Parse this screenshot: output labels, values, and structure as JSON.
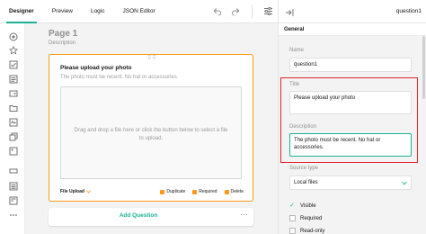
{
  "tabs": [
    {
      "label": "Designer",
      "active": true
    },
    {
      "label": "Preview",
      "active": false
    },
    {
      "label": "Logic",
      "active": false
    },
    {
      "label": "JSON Editor",
      "active": false
    }
  ],
  "toolbar": {
    "icons": [
      "undo-icon",
      "redo-icon",
      "settings-icon"
    ]
  },
  "rail": {
    "icons": [
      "circle-radio-icon",
      "star-rating-icon",
      "checkbox-icon",
      "list-icon",
      "dropdown-icon",
      "file-icon",
      "text-block-icon",
      "copy-icon",
      "image-icon",
      "input-icon",
      "panel-icon",
      "more-icon"
    ]
  },
  "page": {
    "title": "Page 1",
    "description": "Description"
  },
  "question": {
    "title": "Please upload your photo",
    "description": "The photo must be recent. No hat or accessories.",
    "dropzone_text": "Drag and drop a file here or click the button below to select a file to upload.",
    "type_label": "File Upload",
    "actions": {
      "duplicate": "Duplicate",
      "required": "Required",
      "delete": "Delete"
    },
    "drag_handle": "⠿⠿"
  },
  "add_question": {
    "label": "Add Question",
    "more": "···"
  },
  "panel": {
    "question_name": "question1",
    "section": "General",
    "name_label": "Name",
    "name_value": "question1",
    "title_label": "Title",
    "title_value": "Please upload your photo",
    "description_label": "Description",
    "description_value": "The photo must be recent. No hat or accessories.",
    "source_type_label": "Source type",
    "source_type_value": "Local files",
    "visible_label": "Visible",
    "required_label": "Required",
    "readonly_label": "Read-only"
  },
  "colors": {
    "accent": "#19b394",
    "selection": "#ff9814",
    "highlight": "#e0242b"
  }
}
